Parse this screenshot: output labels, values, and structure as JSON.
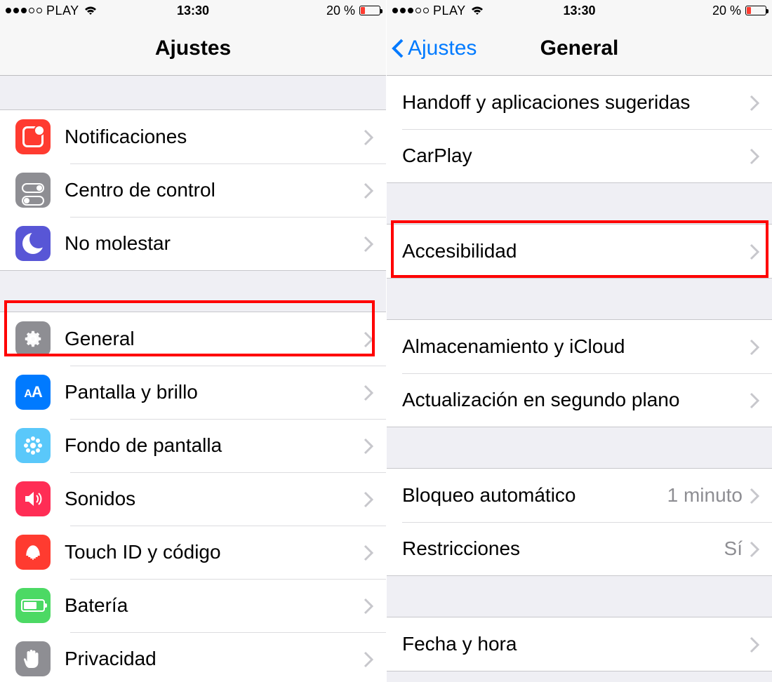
{
  "status": {
    "carrier": "PLAY",
    "time": "13:30",
    "battery_text": "20 %"
  },
  "left": {
    "nav_title": "Ajustes",
    "group1": [
      {
        "key": "notifications",
        "label": "Notificaciones"
      },
      {
        "key": "control-center",
        "label": "Centro de control"
      },
      {
        "key": "dnd",
        "label": "No molestar"
      }
    ],
    "group2": [
      {
        "key": "general",
        "label": "General"
      },
      {
        "key": "display",
        "label": "Pantalla y brillo"
      },
      {
        "key": "wallpaper",
        "label": "Fondo de pantalla"
      },
      {
        "key": "sounds",
        "label": "Sonidos"
      },
      {
        "key": "touchid",
        "label": "Touch ID y código"
      },
      {
        "key": "battery",
        "label": "Batería"
      },
      {
        "key": "privacy",
        "label": "Privacidad"
      }
    ]
  },
  "right": {
    "nav_back": "Ajustes",
    "nav_title": "General",
    "group1": [
      {
        "key": "handoff",
        "label": "Handoff y aplicaciones sugeridas"
      },
      {
        "key": "carplay",
        "label": "CarPlay"
      }
    ],
    "group2": [
      {
        "key": "accessibility",
        "label": "Accesibilidad"
      }
    ],
    "group3": [
      {
        "key": "storage",
        "label": "Almacenamiento y iCloud"
      },
      {
        "key": "bgrefresh",
        "label": "Actualización en segundo plano"
      }
    ],
    "group4": [
      {
        "key": "autolock",
        "label": "Bloqueo automático",
        "value": "1 minuto"
      },
      {
        "key": "restrictions",
        "label": "Restricciones",
        "value": "Sí"
      }
    ],
    "group5": [
      {
        "key": "datetime",
        "label": "Fecha y hora"
      }
    ]
  }
}
